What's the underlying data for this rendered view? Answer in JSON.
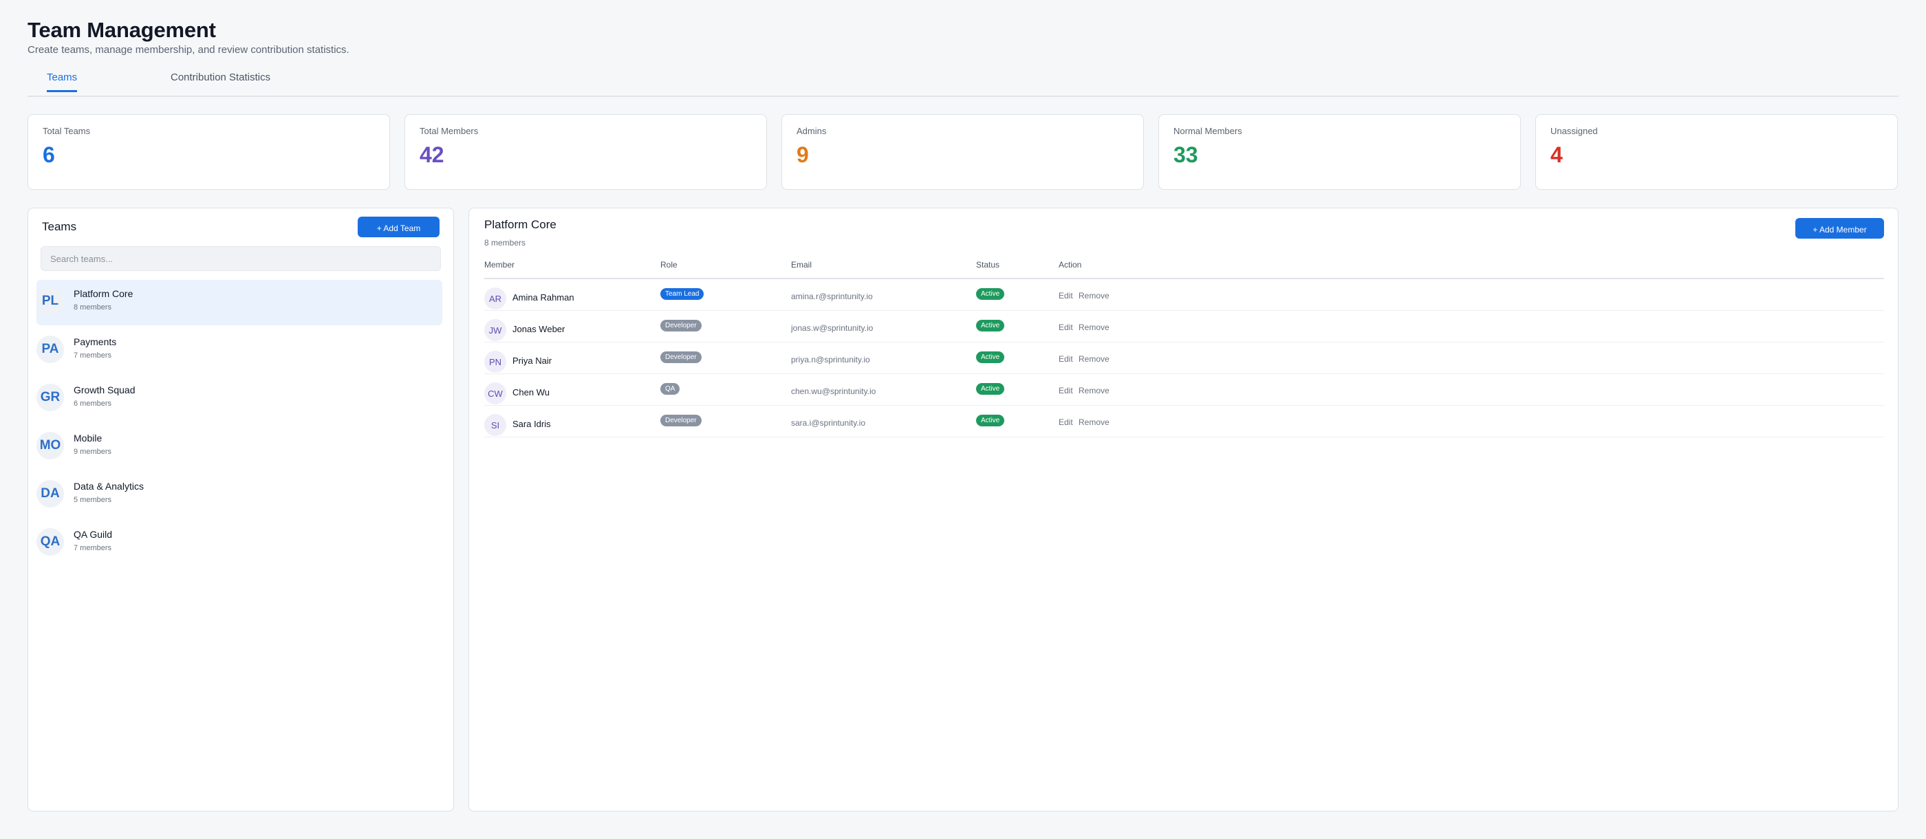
{
  "header": {
    "title": "Team Management",
    "subtitle": "Create teams, manage membership, and review contribution statistics."
  },
  "tabs": [
    {
      "label": "Teams",
      "active": true
    },
    {
      "label": "Contribution Statistics",
      "active": false
    }
  ],
  "stats": [
    {
      "label": "Total Teams",
      "value": "6",
      "color": "#1a6fe0"
    },
    {
      "label": "Total Members",
      "value": "42",
      "color": "#6a4fc2"
    },
    {
      "label": "Admins",
      "value": "9",
      "color": "#e07b1a"
    },
    {
      "label": "Normal Members",
      "value": "33",
      "color": "#1e9a5e"
    },
    {
      "label": "Unassigned",
      "value": "4",
      "color": "#d93025"
    }
  ],
  "teams_panel": {
    "title": "Teams",
    "add_button": "+ Add Team",
    "search_placeholder": "Search teams...",
    "teams": [
      {
        "initials": "PL",
        "name": "Platform Core",
        "count": "8 members",
        "selected": true
      },
      {
        "initials": "PA",
        "name": "Payments",
        "count": "7 members",
        "selected": false
      },
      {
        "initials": "GR",
        "name": "Growth Squad",
        "count": "6 members",
        "selected": false
      },
      {
        "initials": "MO",
        "name": "Mobile",
        "count": "9 members",
        "selected": false
      },
      {
        "initials": "DA",
        "name": "Data & Analytics",
        "count": "5 members",
        "selected": false
      },
      {
        "initials": "QA",
        "name": "QA Guild",
        "count": "7 members",
        "selected": false
      }
    ]
  },
  "members_panel": {
    "team_name": "Platform Core",
    "member_count": "8 members",
    "add_button": "+ Add Member",
    "columns": {
      "member": "Member",
      "role": "Role",
      "email": "Email",
      "status": "Status",
      "action": "Action"
    },
    "edit_label": "Edit",
    "remove_label": "Remove",
    "members": [
      {
        "initials": "AR",
        "name": "Amina Rahman",
        "role": "Team Lead",
        "email": "amina.r@sprintunity.io",
        "status": "Active"
      },
      {
        "initials": "JW",
        "name": "Jonas Weber",
        "role": "Developer",
        "email": "jonas.w@sprintunity.io",
        "status": "Active"
      },
      {
        "initials": "PN",
        "name": "Priya Nair",
        "role": "Developer",
        "email": "priya.n@sprintunity.io",
        "status": "Active"
      },
      {
        "initials": "CW",
        "name": "Chen Wu",
        "role": "QA",
        "email": "chen.wu@sprintunity.io",
        "status": "Active"
      },
      {
        "initials": "SI",
        "name": "Sara Idris",
        "role": "Developer",
        "email": "sara.i@sprintunity.io",
        "status": "Active"
      }
    ]
  }
}
